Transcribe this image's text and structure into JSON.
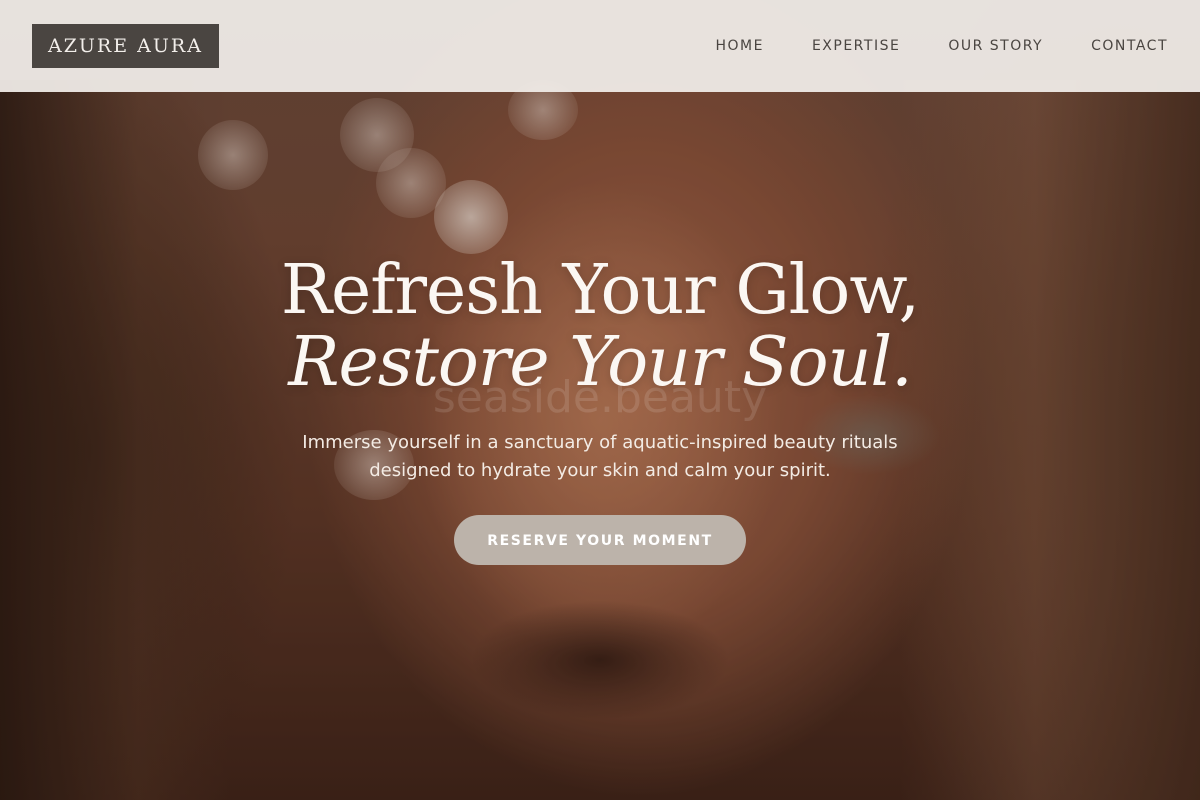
{
  "brand": {
    "logo": "AZURE AURA"
  },
  "nav": {
    "items": [
      {
        "label": "HOME"
      },
      {
        "label": "EXPERTISE"
      },
      {
        "label": "OUR STORY"
      },
      {
        "label": "CONTACT"
      }
    ]
  },
  "hero": {
    "headline_line1": "Refresh Your Glow,",
    "headline_line2": "Restore Your Soul.",
    "watermark": "seaside.beauty",
    "subtitle_line1": "Immerse yourself in a sanctuary of aquatic-inspired beauty rituals",
    "subtitle_line2": "designed to hydrate your skin and calm your spirit.",
    "cta_label": "RESERVE YOUR MOMENT"
  },
  "colors": {
    "header_bg": "#f0ece8",
    "logo_bg": "#4a4541",
    "cta_bg": "#bcb3aa",
    "nav_text": "#4a4541"
  }
}
